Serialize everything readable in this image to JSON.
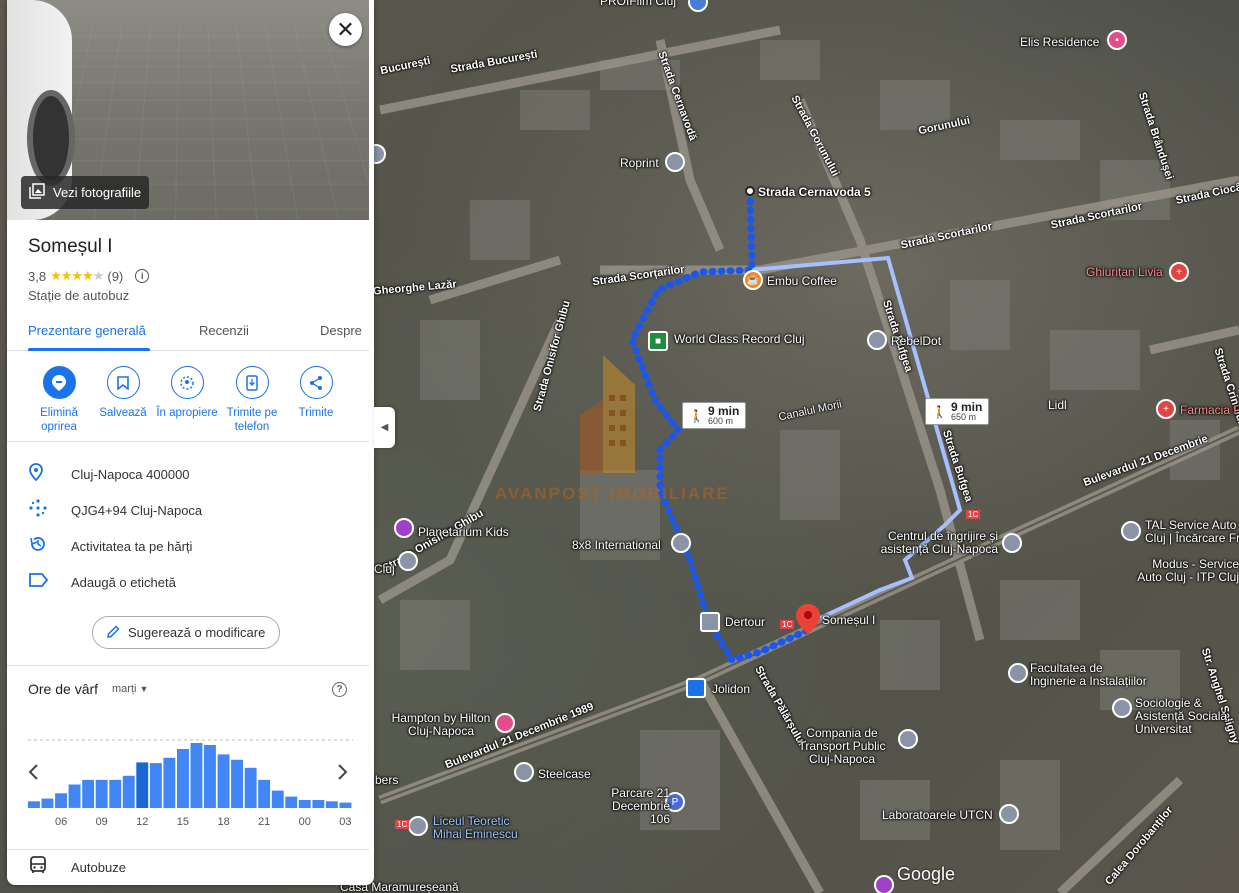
{
  "map": {
    "streets": [
      "Strada București",
      "București",
      "Strada Cernavodă",
      "Strada Gorunului",
      "Gorunului",
      "Strada Scorțarilor",
      "Strada Scortarilor",
      "Strada Scortarilor",
      "Strada Ciocârliei",
      "Strada Onisifor Ghibu",
      "Strada Onisifor Ghibu",
      "Strada Bufgea",
      "Strada Bufgea",
      "Bulevardul 21 Decembrie 1989",
      "Bulevardul 21 Decembrie",
      "Canalul Morii",
      "Strada Pălărșului",
      "Calea Dorobanților",
      "Strada Brândușei",
      "Strada Crinului",
      "Str. Anghel Saligny",
      "Gheorghe Lazăr"
    ],
    "places": [
      "PROIFilm Cluj",
      "Elis Residence",
      "Roprint",
      "Strada Cernavoda 5",
      "Embu Coffee",
      "World Class Record Cluj",
      "RebelDot",
      "Ghiurițan Livia",
      "Farmacia P",
      "Lidl",
      "Planetarium Kids",
      "Cluj",
      "8x8 International",
      "Centrul de îngrijire și asistență Cluj-Napoca",
      "TAL Service Auto Cluj | Încărcare Fr",
      "Modus - Service Auto Cluj - ITP Cluj",
      "Dertour",
      "Someșul I",
      "Jolidon",
      "Hampton by Hilton Cluj-Napoca",
      "Facultatea de Inginerie a Instalațiilor",
      "Sociologie & Asistență Socială, Universitat",
      "Compania de Transport Public Cluj-Napoca",
      "Steelcase",
      "Parcare 21 Decembrie 106",
      "Liceul Teoretic Mihai Eminescu",
      "Laboratoarele UTCN",
      "Casa Maramureșeană",
      "bers"
    ],
    "walk1": {
      "time": "9 min",
      "dist": "600 m"
    },
    "walk2": {
      "time": "9 min",
      "dist": "650 m"
    },
    "watermark": "AVANPOST IMOBILIARE",
    "google": "Google",
    "bus_codes": [
      "1C",
      "1C",
      "1C"
    ]
  },
  "panel": {
    "photos_label": "Vezi fotografiile",
    "title": "Someșul I",
    "rating": "3,8",
    "stars": 3.8,
    "reviews": "(9)",
    "category": "Stație de autobuz",
    "tabs": [
      "Prezentare generală",
      "Recenzii",
      "Despre"
    ],
    "actions": [
      {
        "label": "Elimină oprirea",
        "icon": "pin-remove-icon"
      },
      {
        "label": "Salvează",
        "icon": "bookmark-icon"
      },
      {
        "label": "În apropiere",
        "icon": "nearby-icon"
      },
      {
        "label": "Trimite pe telefon",
        "icon": "phone-icon"
      },
      {
        "label": "Trimite",
        "icon": "share-icon"
      }
    ],
    "rows": [
      {
        "text": "Cluj-Napoca 400000",
        "icon": "location-icon"
      },
      {
        "text": "QJG4+94 Cluj-Napoca",
        "icon": "plus-code-icon"
      },
      {
        "text": "Activitatea ta pe hărți",
        "icon": "history-icon"
      },
      {
        "text": "Adaugă o etichetă",
        "icon": "label-icon"
      }
    ],
    "suggest": "Sugerează o modificare",
    "peak_title": "Ore de vârf",
    "peak_day": "marți",
    "bus_row": "Autobuze"
  },
  "chart_data": {
    "type": "bar",
    "categories": [
      "04",
      "05",
      "06",
      "07",
      "08",
      "09",
      "10",
      "11",
      "12",
      "13",
      "14",
      "15",
      "16",
      "17",
      "18",
      "19",
      "20",
      "21",
      "22",
      "23",
      "00",
      "01",
      "02",
      "03"
    ],
    "values": [
      10,
      14,
      22,
      35,
      42,
      42,
      42,
      48,
      68,
      67,
      75,
      88,
      97,
      94,
      80,
      72,
      60,
      42,
      26,
      17,
      12,
      12,
      10,
      8
    ],
    "highlight_index": 8,
    "tick_labels": [
      "06",
      "09",
      "12",
      "15",
      "18",
      "21",
      "00",
      "03"
    ]
  }
}
